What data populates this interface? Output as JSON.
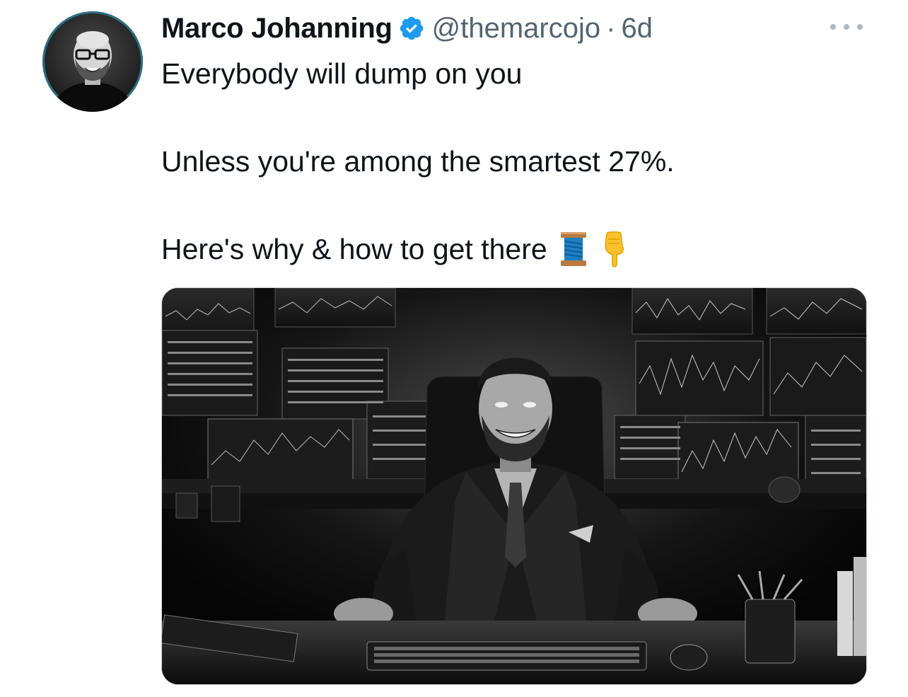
{
  "tweet": {
    "author": {
      "display_name": "Marco Johanning",
      "handle": "@themarcojo",
      "verified": true,
      "avatar_icon": "profile-photo"
    },
    "separator": "·",
    "timestamp": "6d",
    "more_icon": "more-horizontal-icon",
    "lines": [
      "Everybody will dump on you",
      "Unless you're among the smartest 27%.",
      "Here's why & how to get there"
    ],
    "emojis": [
      "spool-of-thread-emoji",
      "backhand-index-pointing-down-emoji"
    ],
    "media": {
      "type": "image",
      "subject": "black-and-white-businessman-at-trading-desk"
    }
  },
  "colors": {
    "text_primary": "#0f1419",
    "text_secondary": "#536471",
    "verified_blue": "#1d9bf0",
    "more_dots": "#aab8c2",
    "media_border": "#cfd9de"
  }
}
